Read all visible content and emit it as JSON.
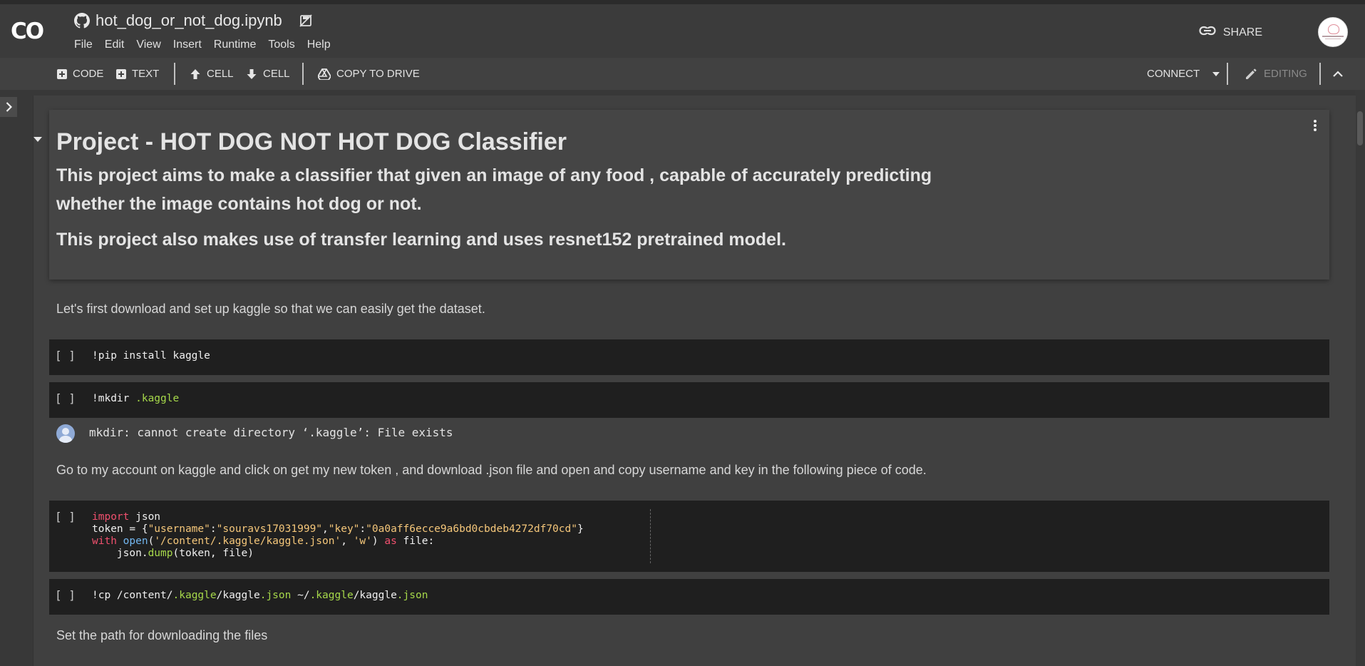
{
  "header": {
    "logo": "CO",
    "notebook_title": "hot_dog_or_not_dog.ipynb",
    "menu": [
      "File",
      "Edit",
      "View",
      "Insert",
      "Runtime",
      "Tools",
      "Help"
    ],
    "share_label": "SHARE"
  },
  "toolbar": {
    "code_label": "CODE",
    "text_label": "TEXT",
    "cell_up_label": "CELL",
    "cell_down_label": "CELL",
    "copy_to_drive_label": "COPY TO DRIVE",
    "connect_label": "CONNECT",
    "editing_label": "EDITING"
  },
  "cells": {
    "title": "Project - HOT DOG NOT HOT DOG Classifier",
    "intro_line1": "This project aims to make a classifier that given an image of any food , capable of accurately predicting",
    "intro_line2": "whether the image contains hot dog or not.",
    "intro_line3": "This project also makes use of transfer learning and uses resnet152 pretrained model.",
    "text_download": "Let's first download and set up kaggle so that we can easily get the dataset.",
    "code1_gutter": "[ ]",
    "code1": "!pip install kaggle",
    "code2_gutter": "[ ]",
    "code2_a": "!mkdir ",
    "code2_b": ".kaggle",
    "output2": "mkdir: cannot create directory ‘.kaggle’: File exists",
    "text_token": "Go to my account on kaggle and click on get my new token , and download .json file and open and copy username and key in the following piece of code.",
    "code3_gutter": "[ ]",
    "code3_import_kw": "import",
    "code3_import_mod": " json",
    "code3_token_a": "token = {",
    "code3_token_k1": "\"username\"",
    "code3_token_c1": ":",
    "code3_token_v1": "\"souravs17031999\"",
    "code3_token_c2": ",",
    "code3_token_k2": "\"key\"",
    "code3_token_c3": ":",
    "code3_token_v2": "\"0a0aff6ecce9a6bd0cbdeb4272df70cd\"",
    "code3_token_z": "}",
    "code3_with_kw": "with",
    "code3_open_fn": " open",
    "code3_open_a": "(",
    "code3_path": "'/content/.kaggle/kaggle.json'",
    "code3_open_b": ", ",
    "code3_mode": "'w'",
    "code3_open_c": ") ",
    "code3_as_kw": "as",
    "code3_open_d": " file:",
    "code3_dump_a": "    json.",
    "code3_dump_fn": "dump",
    "code3_dump_b": "(token, file)",
    "code4_gutter": "[ ]",
    "code4_a": "!cp /content/",
    "code4_b": ".kaggle",
    "code4_c": "/kaggle",
    "code4_d": ".json",
    "code4_e": " ~/",
    "code4_f": ".kaggle",
    "code4_g": "/kaggle",
    "code4_h": ".json",
    "text_path": "Set the path for downloading the files"
  }
}
